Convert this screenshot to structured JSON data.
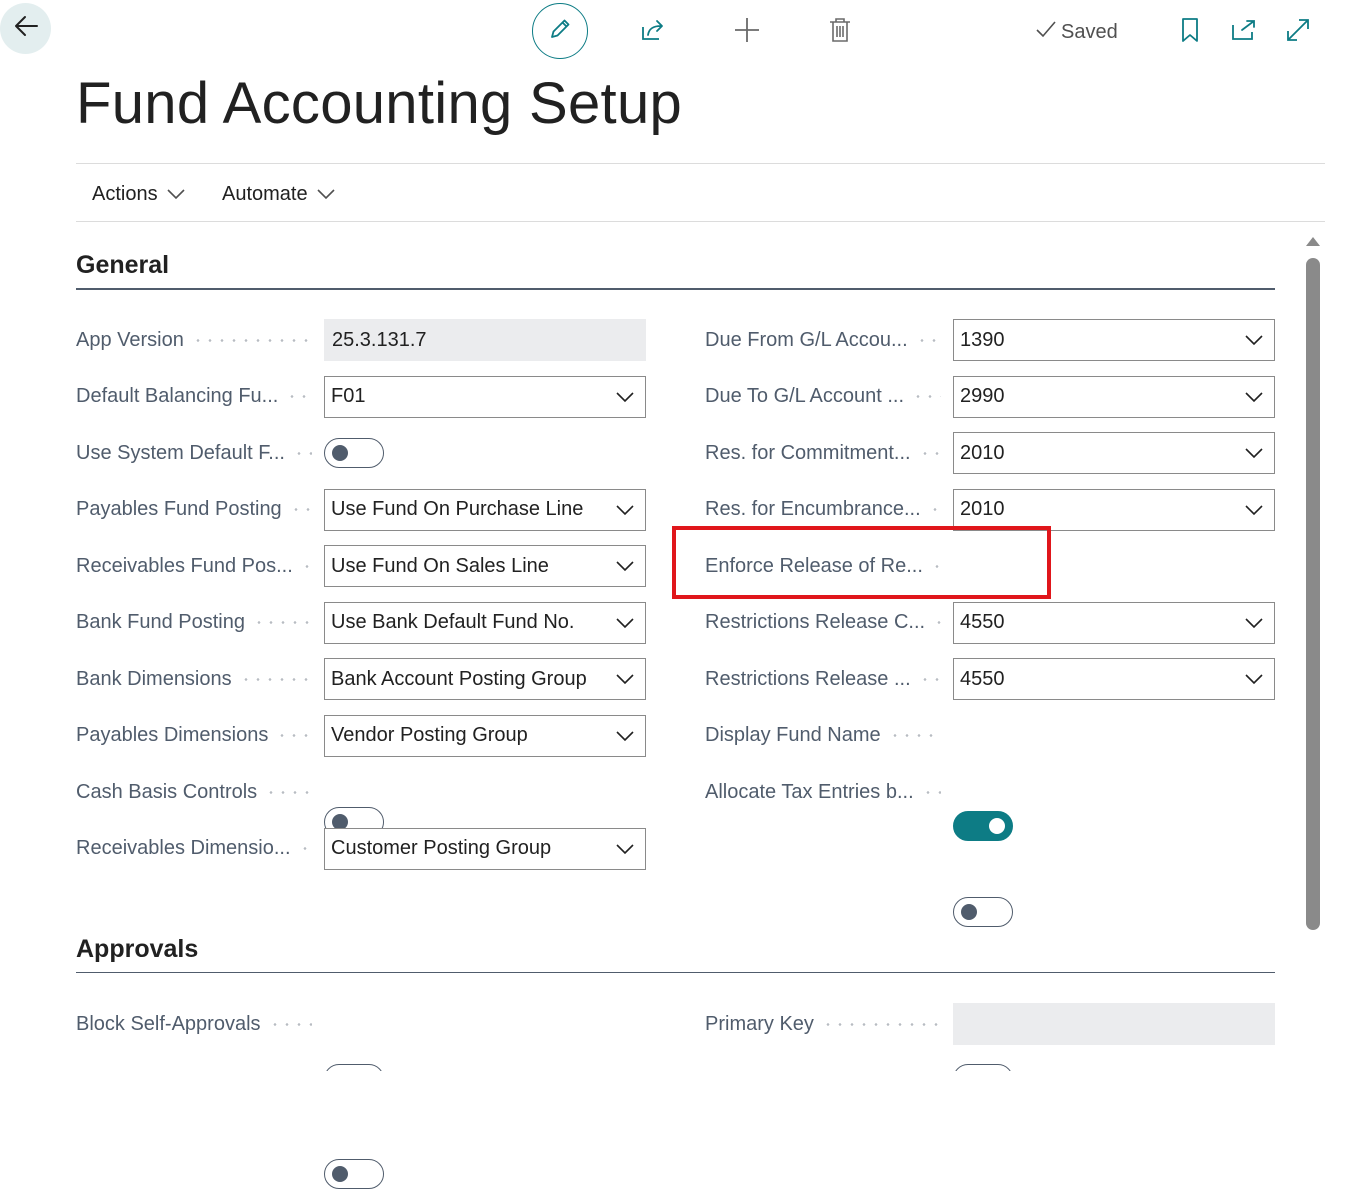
{
  "toolbar": {
    "saved_label": "Saved"
  },
  "page": {
    "title": "Fund Accounting Setup"
  },
  "menu": {
    "actions_label": "Actions",
    "automate_label": "Automate"
  },
  "general": {
    "title": "General",
    "left": [
      {
        "label": "App Version",
        "type": "readonly",
        "value": "25.3.131.7"
      },
      {
        "label": "Default Balancing Fu...",
        "type": "select",
        "value": "F01"
      },
      {
        "label": "Use System Default F...",
        "type": "toggle",
        "on": false
      },
      {
        "label": "Payables Fund Posting",
        "type": "select",
        "value": "Use Fund On Purchase Line"
      },
      {
        "label": "Receivables Fund Pos...",
        "type": "select",
        "value": "Use Fund On Sales Line"
      },
      {
        "label": "Bank Fund Posting",
        "type": "select",
        "value": "Use Bank Default Fund No."
      },
      {
        "label": "Bank Dimensions",
        "type": "select",
        "value": "Bank Account Posting Group"
      },
      {
        "label": "Payables Dimensions",
        "type": "select",
        "value": "Vendor Posting Group"
      },
      {
        "label": "Cash Basis Controls",
        "type": "toggle",
        "on": false
      },
      {
        "label": "Receivables Dimensio...",
        "type": "select",
        "value": "Customer Posting Group"
      }
    ],
    "right": [
      {
        "label": "Due From G/L Accou...",
        "type": "select",
        "value": "1390"
      },
      {
        "label": "Due To G/L Account ...",
        "type": "select",
        "value": "2990"
      },
      {
        "label": "Res. for Commitment...",
        "type": "select",
        "value": "2010"
      },
      {
        "label": "Res. for Encumbrance...",
        "type": "select",
        "value": "2010"
      },
      {
        "label": "Enforce Release of Re...",
        "type": "toggle",
        "on": false
      },
      {
        "label": "Restrictions Release C...",
        "type": "select",
        "value": "4550"
      },
      {
        "label": "Restrictions Release ...",
        "type": "select",
        "value": "4550"
      },
      {
        "label": "Display Fund Name",
        "type": "toggle",
        "on": true
      },
      {
        "label": "Allocate Tax Entries b...",
        "type": "toggle",
        "on": false
      }
    ]
  },
  "approvals": {
    "title": "Approvals",
    "left": [
      {
        "label": "Block Self-Approvals",
        "type": "toggle",
        "on": false
      }
    ],
    "right": [
      {
        "label": "Primary Key",
        "type": "readonly",
        "value": ""
      }
    ]
  },
  "colors": {
    "accent": "#0d7c85",
    "highlight": "#e0161b",
    "label": "#505c6c"
  }
}
